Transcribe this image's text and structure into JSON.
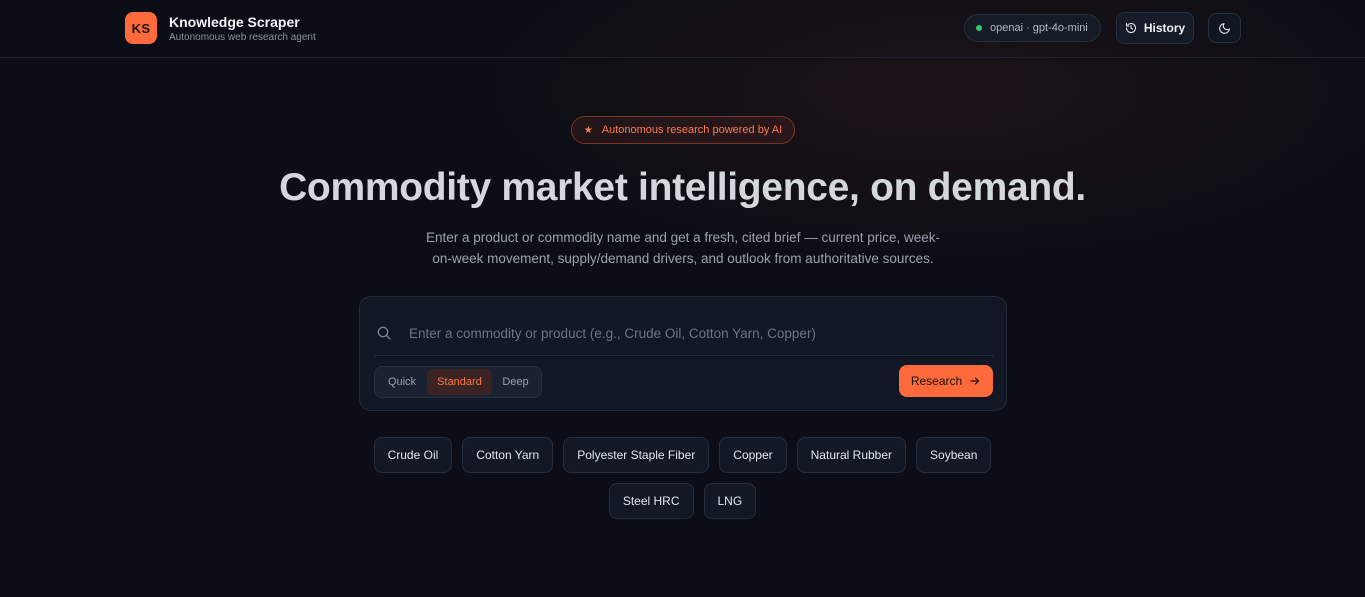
{
  "header": {
    "logo_text": "KS",
    "title": "Knowledge Scraper",
    "subtitle": "Autonomous web research agent",
    "model_status": "openai · gpt-4o-mini",
    "history_label": "History",
    "theme_icon": "moon-icon"
  },
  "hero": {
    "badge": "Autonomous research powered by AI",
    "headline": "Commodity market intelligence, on demand.",
    "description": "Enter a product or commodity name and get a fresh, cited brief — current price, week-on-week movement, supply/demand drivers, and outlook from authoritative sources."
  },
  "search": {
    "placeholder": "Enter a commodity or product (e.g., Crude Oil, Cotton Yarn, Copper)",
    "value": "",
    "depth_options": [
      "Quick",
      "Standard",
      "Deep"
    ],
    "selected_depth": "Standard",
    "submit_label": "Research"
  },
  "suggestions": {
    "row1": [
      "Crude Oil",
      "Cotton Yarn",
      "Polyester Staple Fiber",
      "Copper",
      "Natural Rubber",
      "Soybean"
    ],
    "row2": [
      "Steel HRC",
      "LNG"
    ]
  },
  "colors": {
    "accent": "#ff6a3d",
    "background": "#0b0e16",
    "status_ok": "#2ecc71"
  }
}
